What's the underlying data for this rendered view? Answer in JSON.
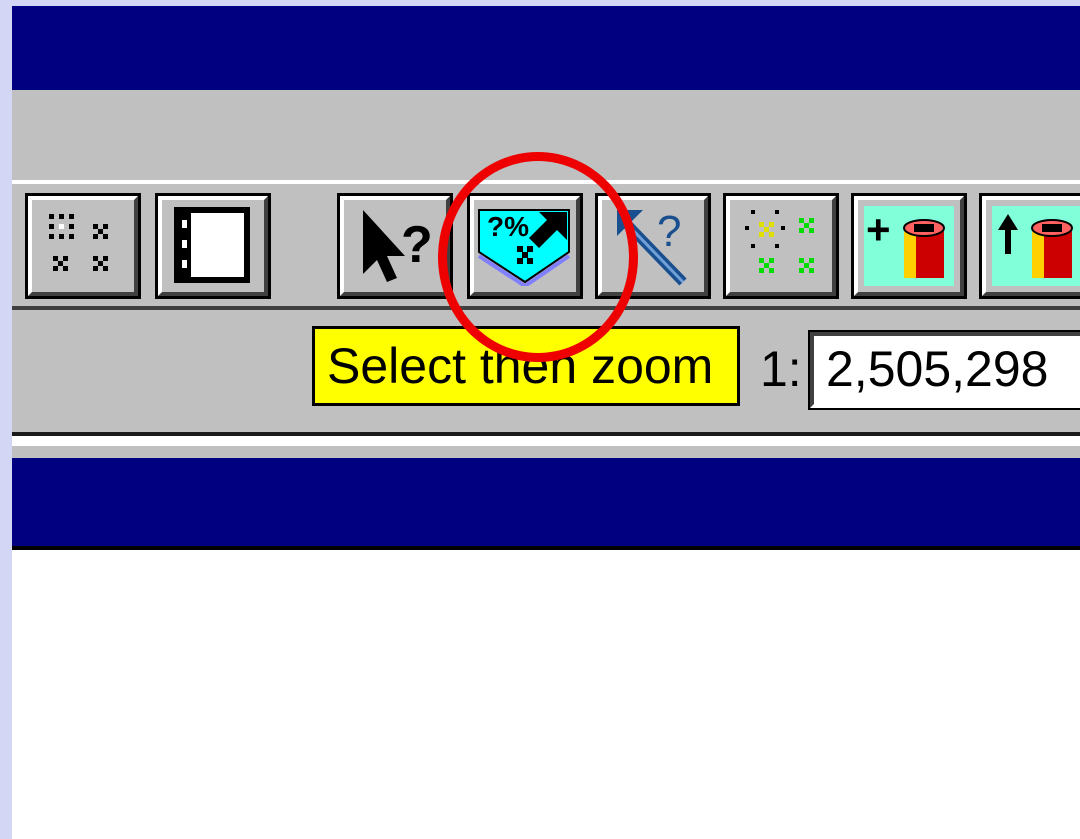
{
  "toolbar": {
    "buttons": [
      {
        "name": "grid-select-button",
        "icon": "node-grid-icon"
      },
      {
        "name": "frame-button",
        "icon": "frame-icon"
      },
      {
        "name": "help-pointer-button",
        "icon": "arrow-question-icon"
      },
      {
        "name": "select-then-zoom-button",
        "icon": "zoom-select-icon"
      },
      {
        "name": "identify-button",
        "icon": "wand-question-icon"
      },
      {
        "name": "node-select-button",
        "icon": "green-nodes-icon"
      },
      {
        "name": "add-layer-button",
        "icon": "add-cylinder-icon"
      },
      {
        "name": "raise-layer-button",
        "icon": "up-cylinder-icon"
      }
    ]
  },
  "tooltip": {
    "text": "Select then zoom"
  },
  "scale": {
    "prefix": "1:",
    "value": "2,505,298"
  },
  "colors": {
    "title_bar": "#000080",
    "face": "#c0c0c0",
    "tooltip_bg": "#ffff00",
    "highlight": "#ee0000",
    "backdrop": "#d4d6f5"
  }
}
